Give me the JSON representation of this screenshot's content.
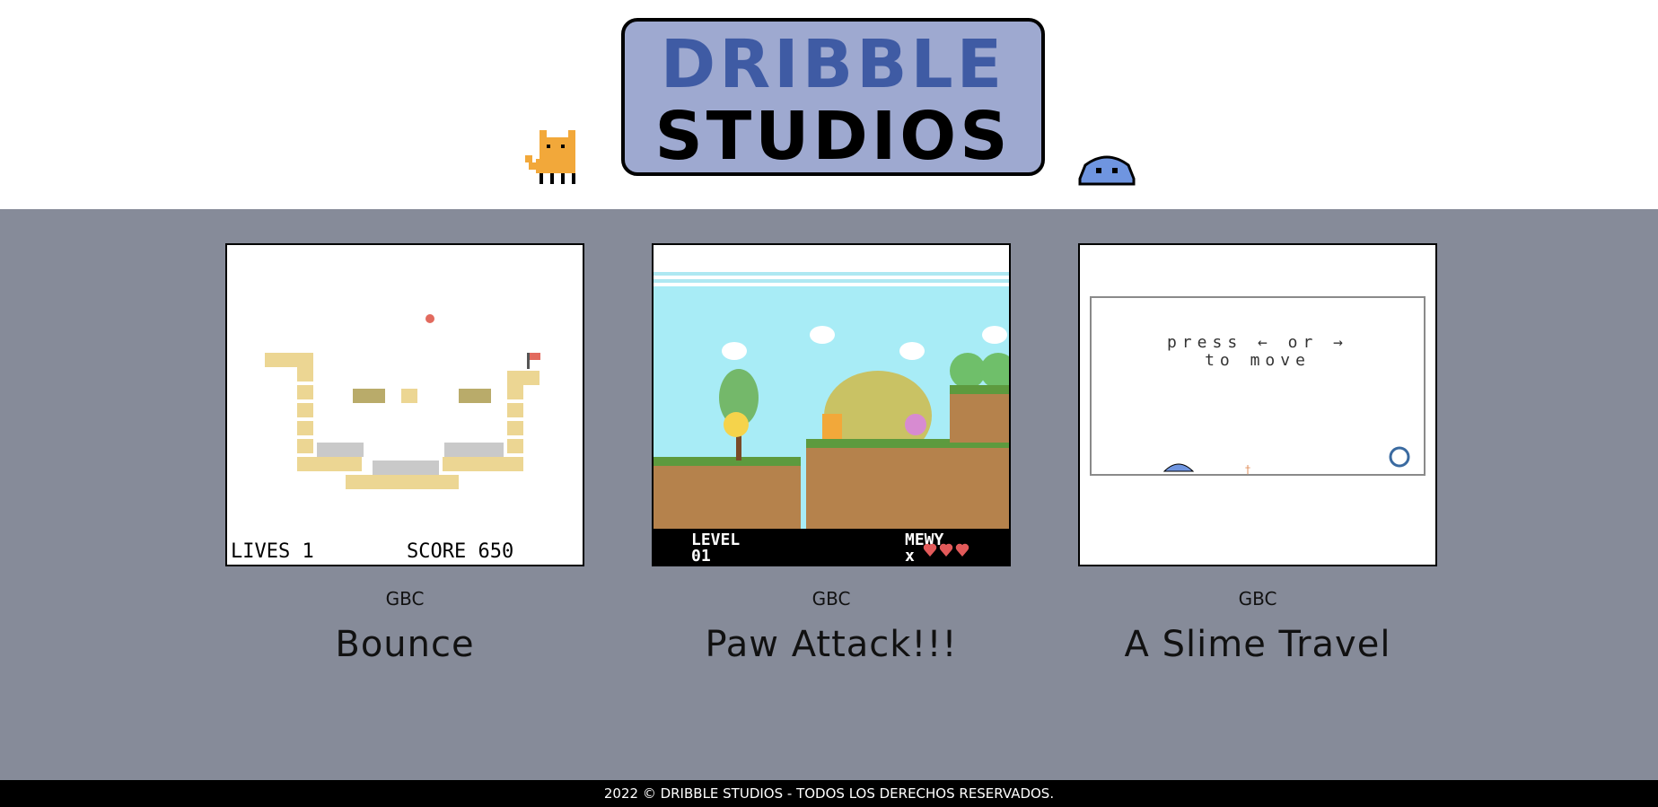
{
  "header": {
    "logo_line1": "DRIBBLE",
    "logo_line2": "STUDIOS"
  },
  "games": [
    {
      "platform": "GBC",
      "title": "Bounce",
      "hud_lives": "LIVES 1",
      "hud_score": "SCORE 650"
    },
    {
      "platform": "GBC",
      "title": "Paw Attack!!!",
      "hud_level": "LEVEL",
      "hud_level_num": "01",
      "hud_name": "MEWY",
      "hud_x": "x"
    },
    {
      "platform": "GBC",
      "title": "A Slime Travel",
      "prompt_line1": "press ← or →",
      "prompt_line2": "to move"
    }
  ],
  "footer": {
    "text": "2022 © DRIBBLE STUDIOS - TODOS LOS DERECHOS RESERVADOS."
  },
  "colors": {
    "background": "#868b99",
    "logo_fill": "#9ea9d0",
    "logo_blue": "#3f5ba4"
  }
}
